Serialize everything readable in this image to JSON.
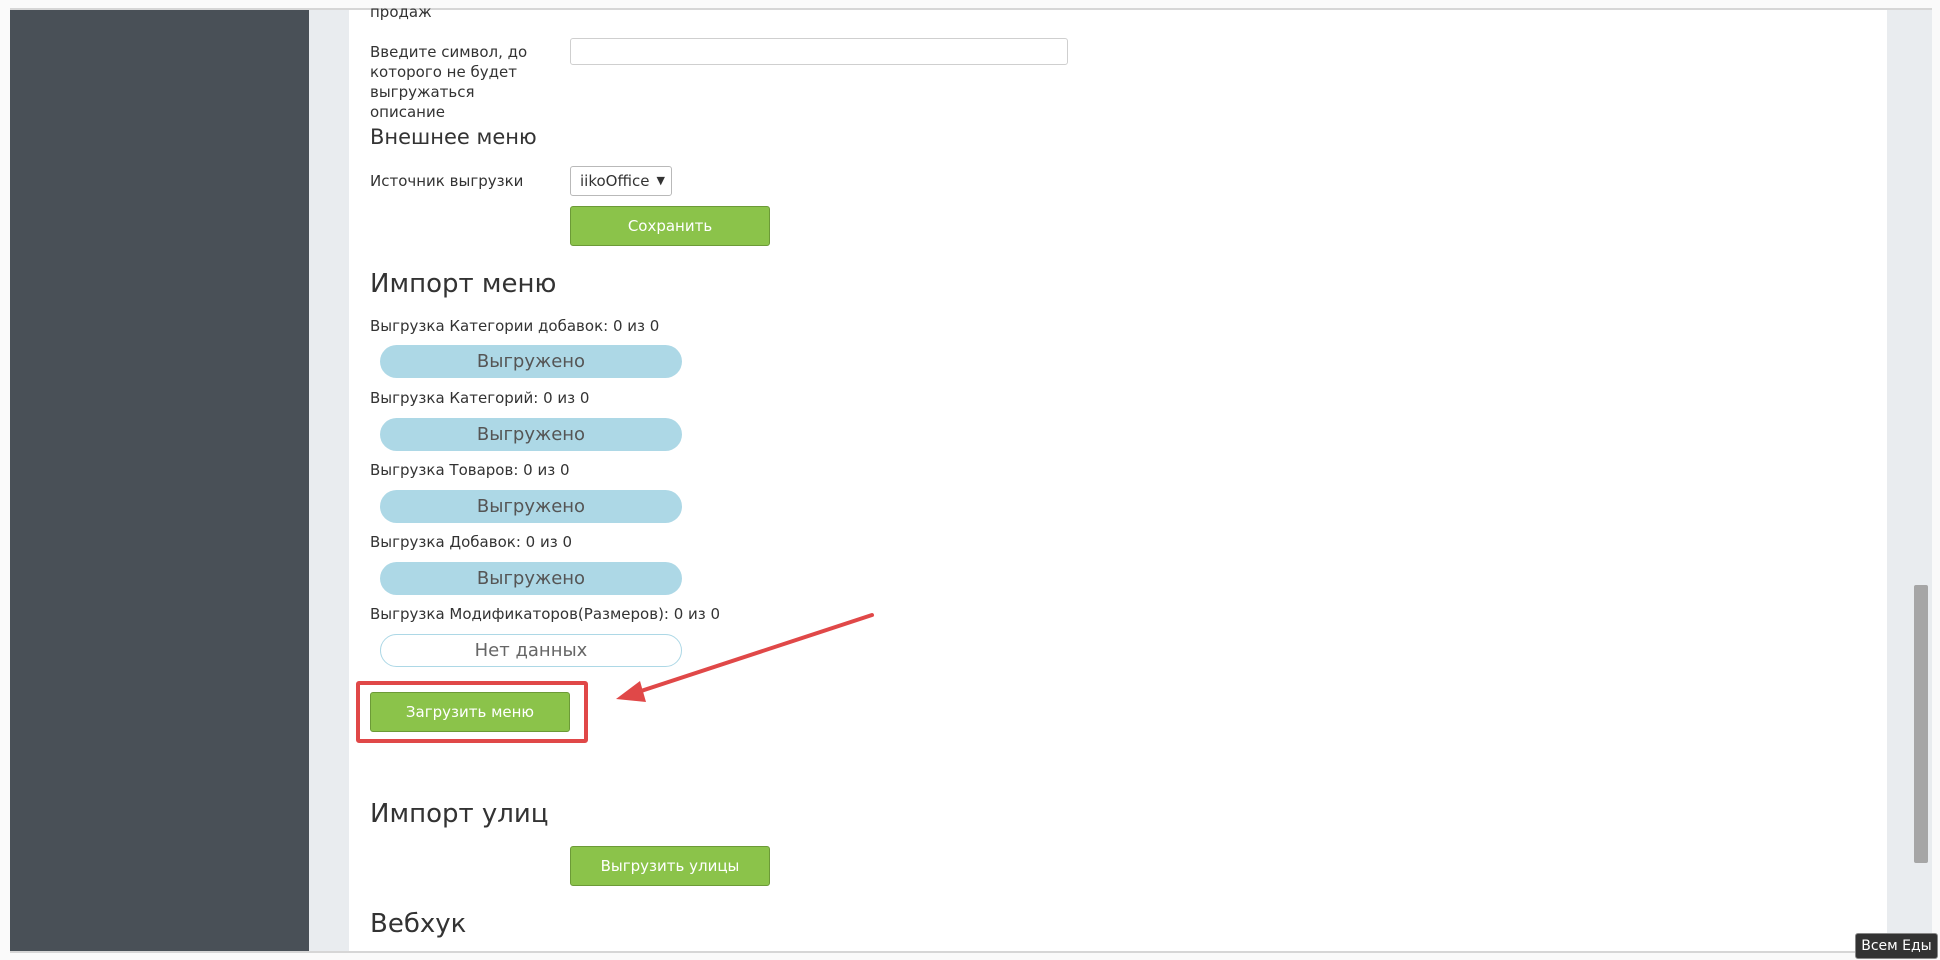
{
  "form": {
    "top_fragment": "продаж",
    "symbol_label": "Введите символ, до которого не будет выгружаться описание",
    "symbol_value": "",
    "external_menu_title": "Внешнее меню",
    "source_label": "Источник выгрузки",
    "source_selected": "iikoOffice",
    "save_button": "Сохранить"
  },
  "import_menu": {
    "title": "Импорт меню",
    "rows": [
      {
        "label": "Выгрузка Категории добавок: 0 из 0",
        "status": "Выгружено"
      },
      {
        "label": "Выгрузка Категорий: 0 из 0",
        "status": "Выгружено"
      },
      {
        "label": "Выгрузка Товаров: 0 из 0",
        "status": "Выгружено"
      },
      {
        "label": "Выгрузка Добавок: 0 из 0",
        "status": "Выгружено"
      },
      {
        "label": "Выгрузка Модификаторов(Размеров): 0 из 0",
        "status": "Нет данных"
      }
    ],
    "load_button": "Загрузить меню"
  },
  "import_streets": {
    "title": "Импорт улиц",
    "button": "Выгрузить улицы"
  },
  "webhook": {
    "title": "Вебхук"
  },
  "tooltip": "Всем Еды",
  "colors": {
    "sidebar": "#495057",
    "accent_green": "#8bc34a",
    "pill_blue": "#add8e6",
    "annotation_red": "#e04848"
  }
}
